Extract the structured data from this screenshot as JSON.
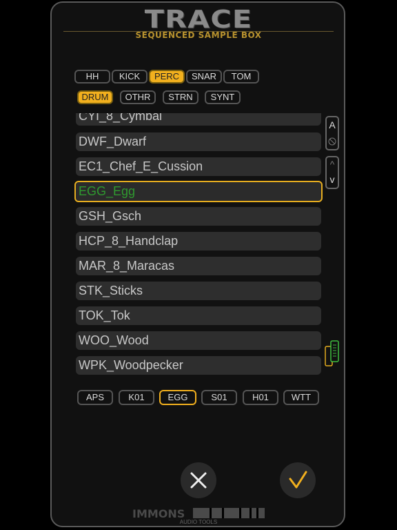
{
  "app": {
    "title": "TRACE",
    "subtitle": "SEQUENCED SAMPLE BOX",
    "footer_brand": "IMMONS",
    "footer_sub": "AUDIO TOOLS"
  },
  "category_tabs_row1": [
    {
      "label": "HH",
      "active": false
    },
    {
      "label": "KICK",
      "active": false
    },
    {
      "label": "PERC",
      "active": true
    },
    {
      "label": "SNAR",
      "active": false
    },
    {
      "label": "TOM",
      "active": false
    }
  ],
  "category_tabs_row2": [
    {
      "label": "DRUM",
      "active": true
    },
    {
      "label": "OTHR",
      "active": false
    },
    {
      "label": "STRN",
      "active": false
    },
    {
      "label": "SYNT",
      "active": false
    }
  ],
  "sample_list": {
    "items": [
      "CYI_8_Cymbal",
      "DWF_Dwarf",
      "EC1_Chef_E_Cussion",
      "EGG_Egg",
      "GSH_Gsch",
      "HCP_8_Handclap",
      "MAR_8_Maracas",
      "STK_Sticks",
      "TOK_Tok",
      "WOO_Wood",
      "WPK_Woodpecker"
    ],
    "selected": "EGG_Egg"
  },
  "side_controls": {
    "alpha_label": "A",
    "up_label": "^",
    "down_label": "v"
  },
  "slot_tabs": [
    {
      "label": "APS",
      "active": false
    },
    {
      "label": "K01",
      "active": false
    },
    {
      "label": "EGG",
      "active": true
    },
    {
      "label": "S01",
      "active": false
    },
    {
      "label": "H01",
      "active": false
    },
    {
      "label": "WTT",
      "active": false
    }
  ],
  "colors": {
    "accent": "#f2b01e",
    "selected_text": "#2f9a2f",
    "row_bg": "#2e2e2e",
    "confirm_check": "#f2b01e",
    "scroll_indicator": "#3fbf3f"
  },
  "actions": {
    "cancel_icon": "close-icon",
    "confirm_icon": "check-icon"
  }
}
